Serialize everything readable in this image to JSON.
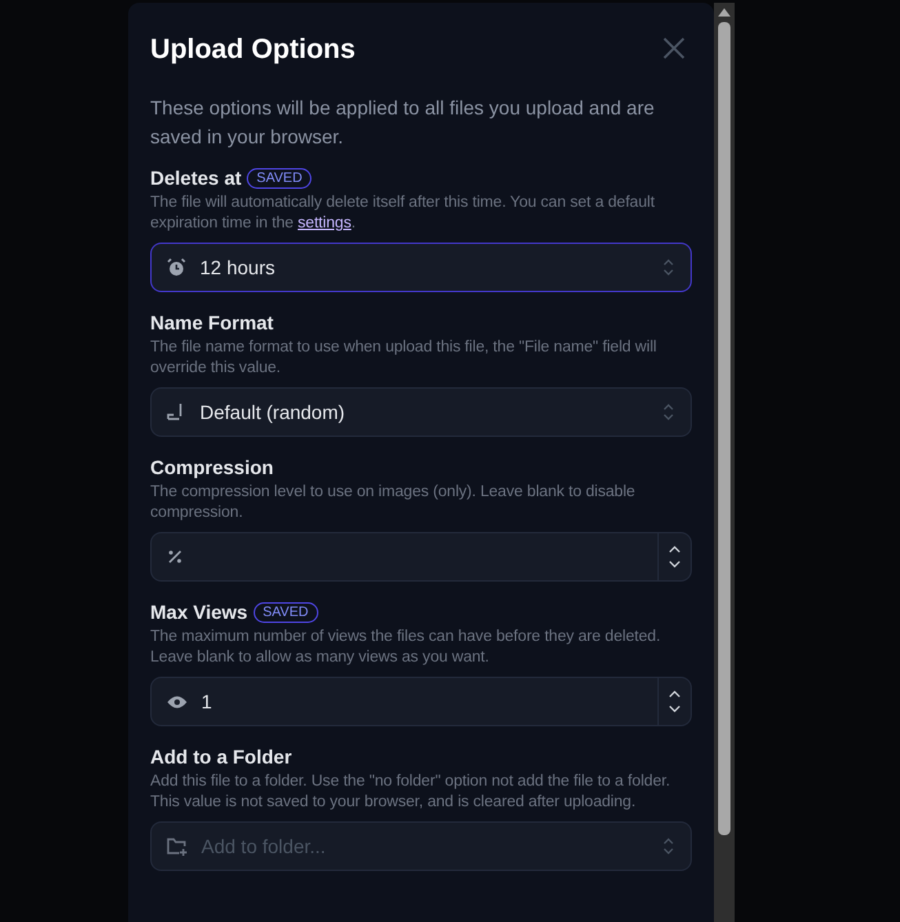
{
  "dialog": {
    "title": "Upload Options",
    "description": "These options will be applied to all files you upload and are saved in your browser."
  },
  "fields": [
    {
      "label": "Deletes at",
      "badge": "SAVED",
      "help": "The file will automatically delete itself after this time. You can set a default expiration time in the ",
      "link": "settings",
      "help_end": ".",
      "kind": "select",
      "value": "12 hours",
      "focused": true
    },
    {
      "label": "Name Format",
      "help": "The file name format to use when upload this file, the \"File name\" field will override this value.",
      "kind": "select",
      "value": "Default (random)",
      "focused": false
    },
    {
      "label": "Compression",
      "help": "The compression level to use on images (only). Leave blank to disable compression.",
      "kind": "number",
      "focused": false
    },
    {
      "label": "Max Views",
      "badge": "SAVED",
      "help": "The maximum number of views the files can have before they are deleted. Leave blank to allow as many views as you want.",
      "kind": "number",
      "value": "1",
      "focused": false
    },
    {
      "label": "Add to a Folder",
      "help": "Add this file to a folder. Use the \"no folder\" option not add the file to a folder. This value is not saved to your browser, and is cleared after uploading.",
      "kind": "select",
      "placeholder": "Add to folder...",
      "focused": false
    }
  ]
}
